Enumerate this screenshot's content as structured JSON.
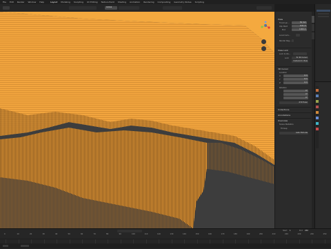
{
  "topbar": {
    "menus": [
      "File",
      "Edit",
      "Render",
      "Window",
      "Help",
      "Layout",
      "Modeling",
      "Sculpting",
      "UV Editing",
      "Texture Paint",
      "Shading",
      "Animation",
      "Rendering",
      "Compositing",
      "Geometry Nodes",
      "Scripting"
    ]
  },
  "header": {
    "orientation_label": "Global"
  },
  "npanel": {
    "view_title": "View",
    "focal_length_label": "Focal Len...",
    "focal_length_value": "50 mm",
    "clip_start_label": "Clip Start",
    "clip_start_value": "0.01 m",
    "clip_end_label": "End",
    "clip_end_value": "1000 m",
    "local_camera_label": "Local Cam...",
    "render_region_label": "Render Reg...",
    "view_lock_title": "View Lock",
    "lock_to_object_label": "Lock to Ob...",
    "lock_label": "Lock",
    "to_3d_cursor_label": "To 3D Cursor",
    "camera_to_view_label": "Camera to View",
    "cursor_title": "3D Cursor",
    "location_label": "Location",
    "x_label": "X",
    "x_value": "0 m",
    "y_label": "Y",
    "y_value": "0 m",
    "z_label": "Z",
    "z_value": "0 m",
    "rotation_label": "Rotation",
    "rx_value": "0°",
    "ry_value": "0°",
    "rz_value": "0°",
    "rotation_mode": "XYZ Euler",
    "collections_title": "Collections",
    "annotations_title": "Annotations",
    "nav_title": "Overview",
    "nav_line1": "Scene Statistics",
    "nav_line2": "Fill Gap",
    "nav_line3": "Auto Extrude"
  },
  "colors": {
    "terrain": "#f2a33c",
    "terrain_dark": "#8a5a1e",
    "accent": "#4772b3",
    "background": "#3d3d3d"
  },
  "timeline": {
    "ticks": [
      "0",
      "10",
      "20",
      "30",
      "40",
      "50",
      "60",
      "70",
      "80",
      "90",
      "100",
      "110",
      "120",
      "130",
      "140",
      "150",
      "160",
      "170",
      "180",
      "190",
      "200",
      "210",
      "220",
      "230",
      "240",
      "250"
    ],
    "start_label": "Start",
    "start_value": "1",
    "end_label": "End",
    "end_value": "250"
  }
}
